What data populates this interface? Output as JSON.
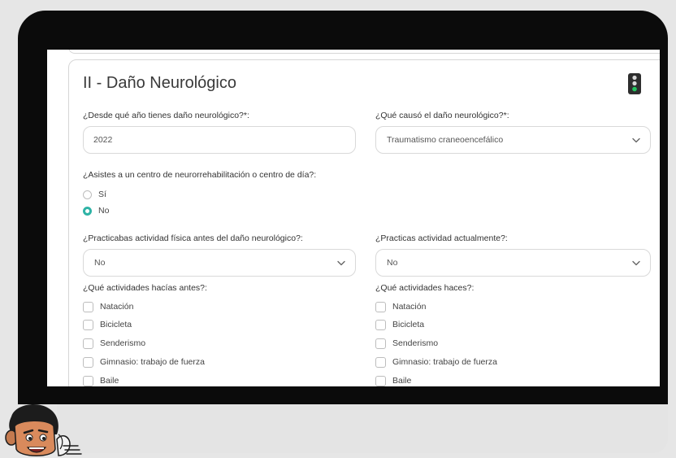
{
  "section": {
    "title": "II - Daño Neurológico"
  },
  "form": {
    "injury_year": {
      "label": "¿Desde qué año tienes daño neurológico?*:",
      "value": "2022"
    },
    "injury_cause": {
      "label": "¿Qué causó el daño neurológico?*:",
      "value": "Traumatismo craneoencefálico"
    },
    "rehab_center": {
      "label": "¿Asistes a un centro de neurorrehabilitación o centro de día?:",
      "options": [
        "Sí",
        "No"
      ],
      "selected": "No"
    },
    "activity_before": {
      "label": "¿Practicabas actividad física antes del daño neurológico?:",
      "value": "No"
    },
    "activity_now": {
      "label": "¿Practicas actividad actualmente?:",
      "value": "No"
    },
    "activities_before": {
      "label": "¿Qué actividades hacías antes?:",
      "options": [
        "Natación",
        "Bicicleta",
        "Senderismo",
        "Gimnasio: trabajo de fuerza",
        "Baile"
      ]
    },
    "activities_now": {
      "label": "¿Qué actividades haces?:",
      "options": [
        "Natación",
        "Bicicleta",
        "Senderismo",
        "Gimnasio: trabajo de fuerza",
        "Baile"
      ]
    }
  },
  "colors": {
    "accent": "#2fb3a6",
    "traffic_light_green": "#22c55e",
    "frame": "#0b0b0b"
  },
  "icons": {
    "status": "traffic-light-icon",
    "select": "chevron-down-icon"
  }
}
